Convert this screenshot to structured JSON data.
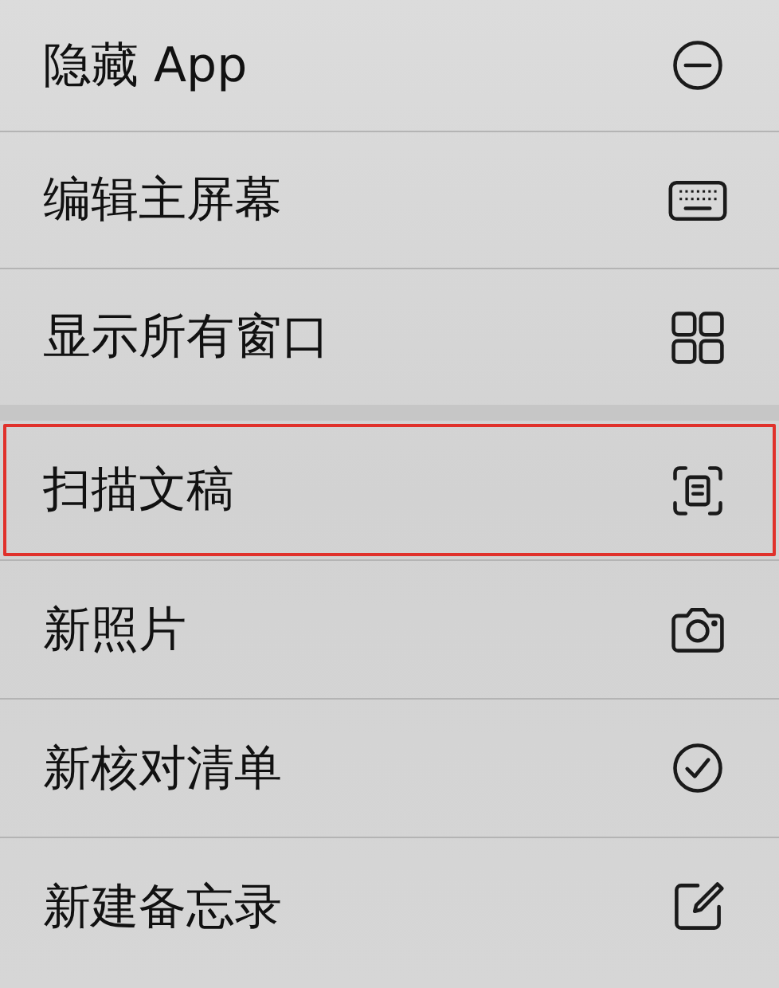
{
  "menu": {
    "groups": [
      {
        "items": [
          {
            "label": "隐藏 App",
            "highlighted": false
          },
          {
            "label": "编辑主屏幕",
            "highlighted": false
          },
          {
            "label": "显示所有窗口",
            "highlighted": false
          }
        ]
      },
      {
        "items": [
          {
            "label": "扫描文稿",
            "highlighted": true
          },
          {
            "label": "新照片",
            "highlighted": false
          },
          {
            "label": "新核对清单",
            "highlighted": false
          },
          {
            "label": "新建备忘录",
            "highlighted": false
          }
        ]
      }
    ]
  }
}
